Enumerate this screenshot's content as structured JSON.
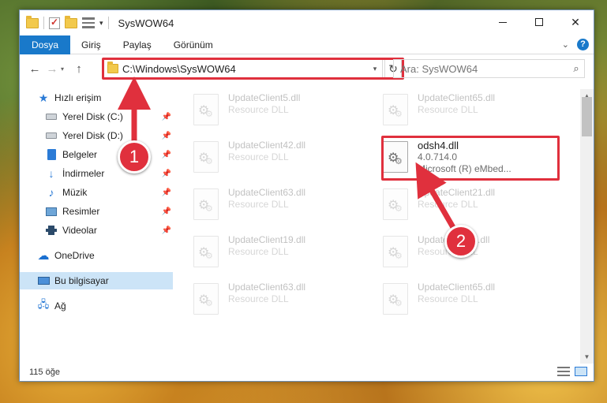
{
  "window": {
    "title": "SysWOW64"
  },
  "ribbon": {
    "tabs": [
      "Dosya",
      "Giriş",
      "Paylaş",
      "Görünüm"
    ],
    "help": "?"
  },
  "navigation": {
    "address": "C:\\Windows\\SysWOW64",
    "search_placeholder": "Ara: SysWOW64"
  },
  "sidebar": {
    "items": [
      {
        "label": "Hızlı erişim",
        "icon": "star-icon"
      },
      {
        "label": "Yerel Disk (C:)",
        "icon": "drive-icon"
      },
      {
        "label": "Yerel Disk (D:)",
        "icon": "drive-icon"
      },
      {
        "label": "Belgeler",
        "icon": "documents-icon"
      },
      {
        "label": "İndirmeler",
        "icon": "download-icon"
      },
      {
        "label": "Müzik",
        "icon": "music-icon"
      },
      {
        "label": "Resimler",
        "icon": "pictures-icon"
      },
      {
        "label": "Videolar",
        "icon": "video-icon"
      },
      {
        "label": "OneDrive",
        "icon": "cloud-icon"
      },
      {
        "label": "Bu bilgisayar",
        "icon": "computer-icon"
      },
      {
        "label": "Ağ",
        "icon": "network-icon"
      }
    ]
  },
  "files": [
    {
      "name": "UpdateClient5.dll",
      "sub1": "Resource DLL",
      "sub2": ""
    },
    {
      "name": "UpdateClient65.dll",
      "sub1": "Resource DLL",
      "sub2": ""
    },
    {
      "name": "UpdateClient42.dll",
      "sub1": "Resource DLL",
      "sub2": ""
    },
    {
      "name": "odsh4.dll",
      "sub1": "4.0.714.0",
      "sub2": "Microsoft (R) eMbed..."
    },
    {
      "name": "UpdateClient63.dll",
      "sub1": "Resource DLL",
      "sub2": ""
    },
    {
      "name": "UpdateClient21.dll",
      "sub1": "Resource DLL",
      "sub2": ""
    },
    {
      "name": "UpdateClient19.dll",
      "sub1": "Resource DLL",
      "sub2": ""
    },
    {
      "name": "UpdateClient5.dll",
      "sub1": "Resource DLL",
      "sub2": ""
    },
    {
      "name": "UpdateClient63.dll",
      "sub1": "Resource DLL",
      "sub2": ""
    },
    {
      "name": "UpdateClient65.dll",
      "sub1": "Resource DLL",
      "sub2": ""
    }
  ],
  "status": {
    "count": "115 öğe"
  },
  "callouts": {
    "one": "1",
    "two": "2"
  },
  "colors": {
    "accent": "#1979ca",
    "highlight": "#e0303d",
    "selection": "#cce4f7"
  }
}
